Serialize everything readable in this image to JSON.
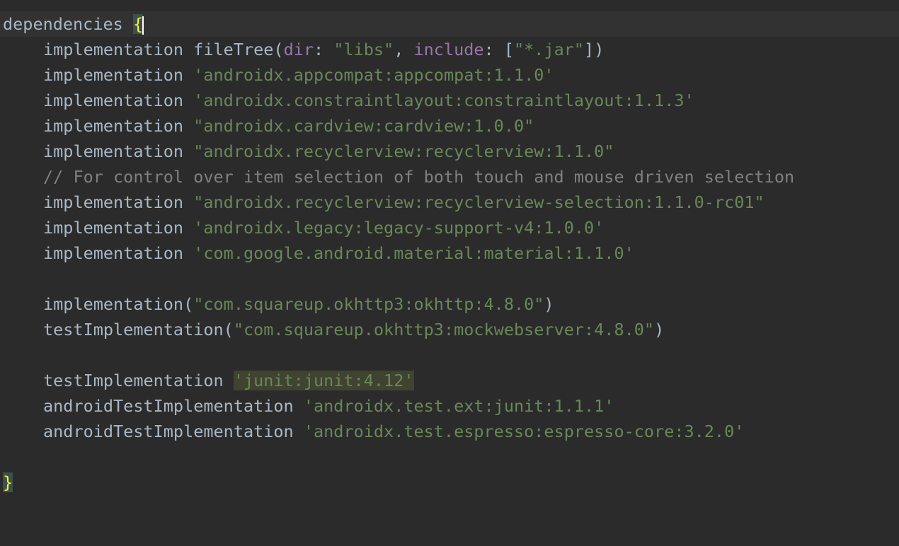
{
  "editor": {
    "lines": [
      {
        "id": "l1",
        "tokens": [
          {
            "t": "dependencies ",
            "c": "plain"
          },
          {
            "t": "{",
            "c": "brace-match"
          }
        ]
      },
      {
        "id": "l2",
        "tokens": [
          {
            "t": "implementation fileTree(",
            "c": "plain"
          },
          {
            "t": "dir",
            "c": "param"
          },
          {
            "t": ": ",
            "c": "plain"
          },
          {
            "t": "\"libs\"",
            "c": "str"
          },
          {
            "t": ", ",
            "c": "plain"
          },
          {
            "t": "include",
            "c": "param"
          },
          {
            "t": ": [",
            "c": "plain"
          },
          {
            "t": "\"*.jar\"",
            "c": "str"
          },
          {
            "t": "])",
            "c": "plain"
          }
        ]
      },
      {
        "id": "l3",
        "tokens": [
          {
            "t": "implementation ",
            "c": "plain"
          },
          {
            "t": "'androidx.appcompat:appcompat:1.1.0'",
            "c": "str"
          }
        ]
      },
      {
        "id": "l4",
        "tokens": [
          {
            "t": "implementation ",
            "c": "plain"
          },
          {
            "t": "'androidx.constraintlayout:constraintlayout:1.1.3'",
            "c": "str"
          }
        ]
      },
      {
        "id": "l5",
        "tokens": [
          {
            "t": "implementation ",
            "c": "plain"
          },
          {
            "t": "\"androidx.cardview:cardview:1.0.0\"",
            "c": "str"
          }
        ]
      },
      {
        "id": "l6",
        "tokens": [
          {
            "t": "implementation ",
            "c": "plain"
          },
          {
            "t": "\"androidx.recyclerview:recyclerview:1.1.0\"",
            "c": "str"
          }
        ]
      },
      {
        "id": "l7",
        "tokens": [
          {
            "t": "// For control over item selection of both touch and mouse driven selection",
            "c": "comment"
          }
        ]
      },
      {
        "id": "l8",
        "tokens": [
          {
            "t": "implementation ",
            "c": "plain"
          },
          {
            "t": "\"androidx.recyclerview:recyclerview-selection:1.1.0-rc01\"",
            "c": "str"
          }
        ]
      },
      {
        "id": "l9",
        "tokens": [
          {
            "t": "implementation ",
            "c": "plain"
          },
          {
            "t": "'androidx.legacy:legacy-support-v4:1.0.0'",
            "c": "str"
          }
        ]
      },
      {
        "id": "l10",
        "tokens": [
          {
            "t": "implementation ",
            "c": "plain"
          },
          {
            "t": "'com.google.android.material:material:1.1.0'",
            "c": "str"
          }
        ]
      },
      {
        "id": "l11",
        "tokens": []
      },
      {
        "id": "l12",
        "tokens": [
          {
            "t": "implementation(",
            "c": "plain"
          },
          {
            "t": "\"com.squareup.okhttp3:okhttp:4.8.0\"",
            "c": "str"
          },
          {
            "t": ")",
            "c": "plain"
          }
        ]
      },
      {
        "id": "l13",
        "tokens": [
          {
            "t": "testImplementation(",
            "c": "plain"
          },
          {
            "t": "\"com.squareup.okhttp3:mockwebserver:4.8.0\"",
            "c": "str"
          },
          {
            "t": ")",
            "c": "plain"
          }
        ]
      },
      {
        "id": "l14",
        "tokens": []
      },
      {
        "id": "l15",
        "tokens": [
          {
            "t": "testImplementation ",
            "c": "plain"
          },
          {
            "t": "'junit:junit:4.12'",
            "c": "str-highlight"
          }
        ]
      },
      {
        "id": "l16",
        "tokens": [
          {
            "t": "androidTestImplementation ",
            "c": "plain"
          },
          {
            "t": "'androidx.test.ext:junit:1.1.1'",
            "c": "str"
          }
        ]
      },
      {
        "id": "l17",
        "tokens": [
          {
            "t": "androidTestImplementation ",
            "c": "plain"
          },
          {
            "t": "'androidx.test.espresso:espresso-core:3.2.0'",
            "c": "str"
          }
        ]
      },
      {
        "id": "l18",
        "tokens": []
      },
      {
        "id": "l19",
        "tokens": [
          {
            "t": "}",
            "c": "brace-match"
          }
        ]
      }
    ]
  }
}
